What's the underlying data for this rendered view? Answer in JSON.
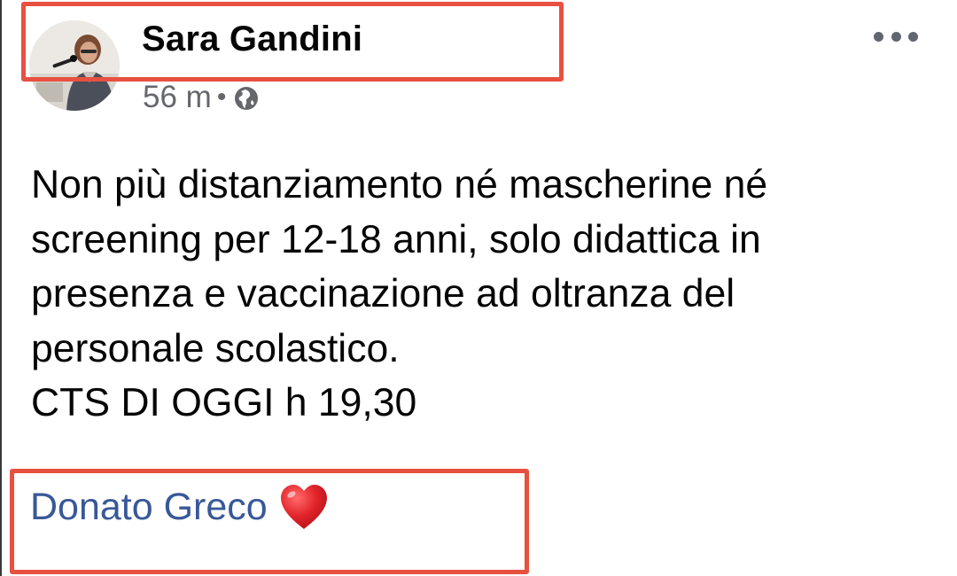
{
  "post": {
    "author": "Sara Gandini",
    "time": "56 m",
    "separator": "•",
    "privacy_icon": "globe-icon",
    "more_icon": "more-options-icon",
    "text_lines": [
      "Non più distanziamento né mascherine né",
      "screening per 12-18 anni, solo didattica in",
      "presenza e vaccinazione ad oltranza del",
      "personale scolastico.",
      "CTS DI OGGI h 19,30"
    ],
    "mention": {
      "name": "Donato Greco",
      "emoji": "heart-icon"
    }
  },
  "colors": {
    "highlight_border": "#e8503f",
    "mention_link": "#385898",
    "meta_text": "#65676b",
    "heart": "#e3242b"
  }
}
